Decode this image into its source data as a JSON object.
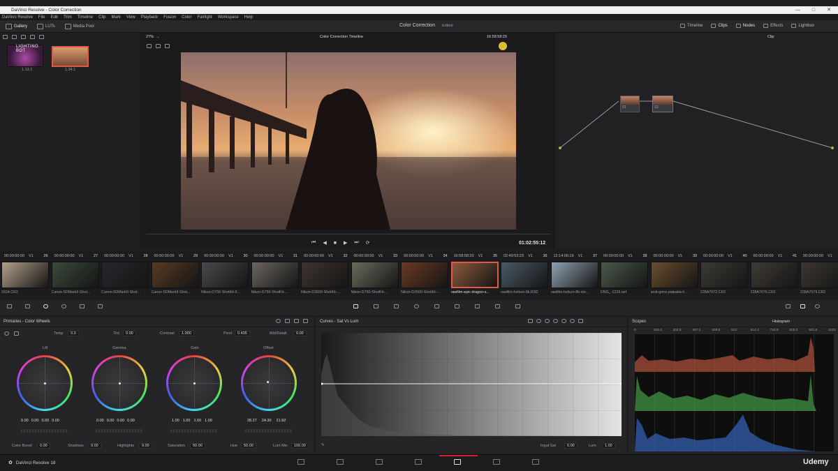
{
  "app": {
    "title": "DaVinci Resolve - Color Correction",
    "window_controls": [
      "—",
      "□",
      "✕"
    ]
  },
  "menu": [
    "DaVinci Resolve",
    "File",
    "Edit",
    "Trim",
    "Timeline",
    "Clip",
    "Mark",
    "View",
    "Playback",
    "Fusion",
    "Color",
    "Fairlight",
    "Workspace",
    "Help"
  ],
  "toolbar": {
    "left": [
      "Gallery",
      "LUTs",
      "Media Pool"
    ],
    "center_title": "Color Correction",
    "center_status": "Edited",
    "right": [
      "Timeline",
      "Clips",
      "Nodes",
      "Effects",
      "Lightbox"
    ]
  },
  "viewer": {
    "zoom": "27%",
    "timeline_name": "Color Correction Timeline",
    "timecode": "16:58:58:20",
    "playhead_time": "01:02:55:12",
    "node_mode": "Clip"
  },
  "gallery": {
    "stills": [
      {
        "label": "1.13.1",
        "caption": "LIGHTING BOT"
      },
      {
        "label": "1.34.1",
        "caption": ""
      }
    ]
  },
  "nodes": [
    {
      "label": "01"
    },
    {
      "label": "02"
    }
  ],
  "clips": [
    {
      "tc": "00:00:00:00",
      "track": "V1",
      "num": "",
      "name": "2934.CR2",
      "color": "#b3a08a"
    },
    {
      "tc": "00:00:00:00",
      "track": "V1",
      "num": "26",
      "name": "Canon-5DMarkII-Shot...",
      "color": "#3b4a3a"
    },
    {
      "tc": "00:00:00:00",
      "track": "V1",
      "num": "27",
      "name": "Canon-5DMarkII-Shot...",
      "color": "#25272b"
    },
    {
      "tc": "00:00:00:00",
      "track": "V1",
      "num": "28",
      "name": "Canon-5DMarkII-Shot...",
      "color": "#5a3a22"
    },
    {
      "tc": "00:00:00:00",
      "track": "V1",
      "num": "29",
      "name": "Nikon-D750-ShotKit-6...",
      "color": "#4a4a4e"
    },
    {
      "tc": "00:00:00:00",
      "track": "V1",
      "num": "30",
      "name": "Nikon-D750-ShotKit-...",
      "color": "#6b6660"
    },
    {
      "tc": "00:00:00:00",
      "track": "V1",
      "num": "31",
      "name": "Nikon-D3500-ShotKit-...",
      "color": "#3e3530"
    },
    {
      "tc": "00:00:00:00",
      "track": "V1",
      "num": "32",
      "name": "Nikon-D750-ShotKit-...",
      "color": "#6a6d5c"
    },
    {
      "tc": "00:00:00:00",
      "track": "V1",
      "num": "33",
      "name": "Nikon-D3500-ShotKit-...",
      "color": "#6a3a22"
    },
    {
      "tc": "16:58:58:20",
      "track": "V1",
      "num": "34",
      "name": "rawfilm-epic-dragon-s...",
      "color": "#8a5a3c",
      "selected": true
    },
    {
      "tc": "02:49:53:23",
      "track": "V1",
      "num": "35",
      "name": "rawfilm-helium-8k.R3D",
      "color": "#4a5a66"
    },
    {
      "tc": "12:14:06:19",
      "track": "V1",
      "num": "36",
      "name": "rawfilm-helium-8k-sle...",
      "color": "#8fa2b2"
    },
    {
      "tc": "00:00:00:00",
      "track": "V1",
      "num": "37",
      "name": "DNG_-1226.nef",
      "color": "#4c5a4a"
    },
    {
      "tc": "00:00:00:00",
      "track": "V1",
      "num": "38",
      "name": "amit-gnire-patpatia-h...",
      "color": "#6a4e2e"
    },
    {
      "tc": "00:00:00:00",
      "track": "V1",
      "num": "39",
      "name": "228A7072.CR2",
      "color": "#3c3a34"
    },
    {
      "tc": "00:00:00:00",
      "track": "V1",
      "num": "40",
      "name": "228A7076.CR2",
      "color": "#403b36"
    },
    {
      "tc": "00:00:00:00",
      "track": "V1",
      "num": "41",
      "name": "228A7079.CR2",
      "color": "#3c3731"
    }
  ],
  "primaries": {
    "title": "Primaries - Color Wheels",
    "params_top": [
      {
        "label": "Temp",
        "value": "0.0"
      },
      {
        "label": "Tint",
        "value": "0.00"
      },
      {
        "label": "Contrast",
        "value": "1.000"
      },
      {
        "label": "Pivot",
        "value": "0.435"
      },
      {
        "label": "Mid/Detail",
        "value": "0.00"
      }
    ],
    "wheels": [
      {
        "name": "Lift",
        "values": [
          "0.00",
          "0.00",
          "0.00",
          "0.00"
        ]
      },
      {
        "name": "Gamma",
        "values": [
          "0.00",
          "0.00",
          "0.00",
          "0.00"
        ]
      },
      {
        "name": "Gain",
        "values": [
          "1.00",
          "1.00",
          "1.00",
          "1.00"
        ]
      },
      {
        "name": "Offset",
        "values": [
          "28.27",
          "24.30",
          "21.92"
        ]
      }
    ],
    "params_bottom": [
      {
        "label": "Color Boost",
        "value": "0.00"
      },
      {
        "label": "Shadows",
        "value": "0.00"
      },
      {
        "label": "Highlights",
        "value": "0.00"
      },
      {
        "label": "Saturation",
        "value": "50.00"
      },
      {
        "label": "Hue",
        "value": "50.00"
      },
      {
        "label": "Lum Mix",
        "value": "100.00"
      }
    ]
  },
  "curves": {
    "title": "Curves - Sat Vs Lum",
    "input_sat_label": "Input Sat",
    "input_sat": "0.00",
    "lum_label": "Lum",
    "lum": "1.00"
  },
  "scopes": {
    "title": "Scopes",
    "mode": "Histogram",
    "ticks": [
      "0",
      "102.4",
      "204.8",
      "307.2",
      "409.6",
      "512",
      "614.4",
      "716.8",
      "819.2",
      "921.6",
      "1023"
    ]
  },
  "footer": {
    "app_name": "DaVinci Resolve 18",
    "watermark": "Udemy"
  }
}
